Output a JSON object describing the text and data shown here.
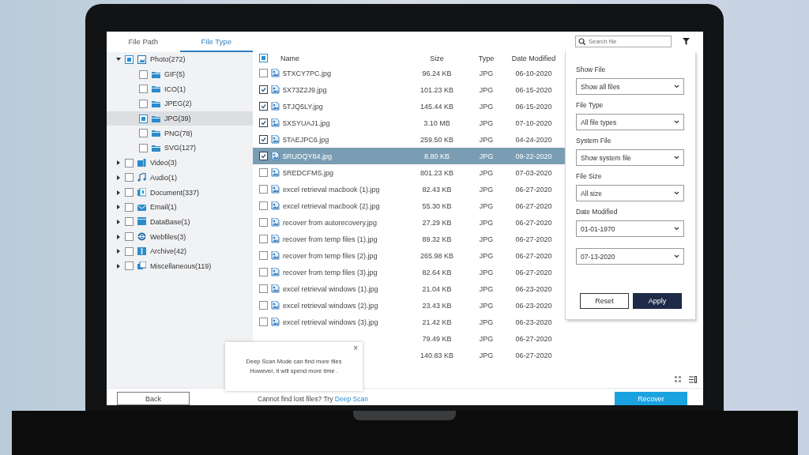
{
  "tabs": [
    {
      "label": "File Path",
      "selected": false
    },
    {
      "label": "File Type",
      "selected": true
    }
  ],
  "tree": [
    {
      "label": "Photo(272)",
      "kind": "image",
      "expanded": true,
      "partial": true,
      "selected": false,
      "children": [
        {
          "label": "GIF(5)",
          "kind": "folder",
          "partial": false,
          "selected": false
        },
        {
          "label": "ICO(1)",
          "kind": "folder",
          "partial": false,
          "selected": false
        },
        {
          "label": "JPEG(2)",
          "kind": "folder",
          "partial": false,
          "selected": false
        },
        {
          "label": "JPG(39)",
          "kind": "folder",
          "partial": true,
          "selected": true
        },
        {
          "label": "PNG(78)",
          "kind": "folder",
          "partial": false,
          "selected": false
        },
        {
          "label": "SVG(127)",
          "kind": "folder",
          "partial": false,
          "selected": false
        }
      ]
    },
    {
      "label": "Video(3)",
      "kind": "video",
      "expanded": false,
      "partial": false,
      "selected": false
    },
    {
      "label": "Audio(1)",
      "kind": "audio",
      "expanded": false,
      "partial": false,
      "selected": false
    },
    {
      "label": "Document(337)",
      "kind": "document",
      "expanded": false,
      "partial": false,
      "selected": false
    },
    {
      "label": "Email(1)",
      "kind": "email",
      "expanded": false,
      "partial": false,
      "selected": false
    },
    {
      "label": "DataBase(1)",
      "kind": "database",
      "expanded": false,
      "partial": false,
      "selected": false
    },
    {
      "label": "Webfiles(3)",
      "kind": "web",
      "expanded": false,
      "partial": false,
      "selected": false
    },
    {
      "label": "Archive(42)",
      "kind": "archive",
      "expanded": false,
      "partial": false,
      "selected": false
    },
    {
      "label": "Miscellaneous(119)",
      "kind": "misc",
      "expanded": false,
      "partial": false,
      "selected": false
    }
  ],
  "table": {
    "select_all": {
      "partial": true
    },
    "columns": [
      "Name",
      "Size",
      "Type",
      "Date Modified"
    ],
    "rows": [
      {
        "name": "5TXCY7PC.jpg",
        "size": "96.24 KB",
        "type": "JPG",
        "date": "06-10-2020",
        "checked": false,
        "selected": false
      },
      {
        "name": "5X73Z2J9.jpg",
        "size": "101.23 KB",
        "type": "JPG",
        "date": "06-15-2020",
        "checked": true,
        "selected": false
      },
      {
        "name": "5TJQ5LY.jpg",
        "size": "145.44 KB",
        "type": "JPG",
        "date": "06-15-2020",
        "checked": true,
        "selected": false
      },
      {
        "name": "5XSYUAJ1.jpg",
        "size": "3.10 MB",
        "type": "JPG",
        "date": "07-10-2020",
        "checked": true,
        "selected": false
      },
      {
        "name": "5TAEJPC6.jpg",
        "size": "259.50 KB",
        "type": "JPG",
        "date": "04-24-2020",
        "checked": true,
        "selected": false
      },
      {
        "name": "5RUDQY84.jpg",
        "size": "8.80 KB",
        "type": "JPG",
        "date": "09-22-2020",
        "checked": true,
        "selected": true
      },
      {
        "name": "5REDCFMS.jpg",
        "size": "801.23 KB",
        "type": "JPG",
        "date": "07-03-2020",
        "checked": false,
        "selected": false
      },
      {
        "name": "excel retrieval macbook (1).jpg",
        "size": "82.43 KB",
        "type": "JPG",
        "date": "06-27-2020",
        "checked": false,
        "selected": false
      },
      {
        "name": "excel retrieval macbook (2).jpg",
        "size": "55.30 KB",
        "type": "JPG",
        "date": "06-27-2020",
        "checked": false,
        "selected": false
      },
      {
        "name": "recover from autorecovery.jpg",
        "size": "27.29 KB",
        "type": "JPG",
        "date": "06-27-2020",
        "checked": false,
        "selected": false
      },
      {
        "name": "recover from temp files (1).jpg",
        "size": "89.32 KB",
        "type": "JPG",
        "date": "06-27-2020",
        "checked": false,
        "selected": false
      },
      {
        "name": "recover from temp files (2).jpg",
        "size": "265.98 KB",
        "type": "JPG",
        "date": "06-27-2020",
        "checked": false,
        "selected": false
      },
      {
        "name": "recover from temp files (3).jpg",
        "size": "82.64 KB",
        "type": "JPG",
        "date": "06-27-2020",
        "checked": false,
        "selected": false
      },
      {
        "name": "excel retrieval windows (1).jpg",
        "size": "21.04 KB",
        "type": "JPG",
        "date": "06-23-2020",
        "checked": false,
        "selected": false
      },
      {
        "name": "excel retrieval windows (2).jpg",
        "size": "23.43 KB",
        "type": "JPG",
        "date": "06-23-2020",
        "checked": false,
        "selected": false
      },
      {
        "name": "excel retrieval windows (3).jpg",
        "size": "21.42 KB",
        "type": "JPG",
        "date": "06-23-2020",
        "checked": false,
        "selected": false
      },
      {
        "size": "79.49 KB",
        "type": "JPG",
        "date": "06-27-2020",
        "selected": false
      },
      {
        "size": "140.83 KB",
        "type": "JPG",
        "date": "06-27-2020",
        "selected": false
      }
    ]
  },
  "search": {
    "placeholder": "Search file"
  },
  "filters": [
    {
      "label": "Show File",
      "value": "Show all files"
    },
    {
      "label": "File Type",
      "value": "All file types"
    },
    {
      "label": "System File",
      "value": "Show system file"
    },
    {
      "label": "File Size",
      "value": "All size"
    },
    {
      "label": "Date Modified",
      "value": "01-01-1970"
    },
    {
      "value": "07-13-2020"
    }
  ],
  "filter_buttons": [
    {
      "label": "Reset",
      "kind": "secondary"
    },
    {
      "label": "Apply",
      "kind": "primary"
    }
  ],
  "popup": {
    "lines": [
      "Deep Scan Mode can find more files",
      "However, it will spend more time ."
    ],
    "close": "×"
  },
  "bottom": {
    "back": "Back",
    "prompt": "Cannot find lost files? Try",
    "link": "Deep Scan",
    "recover": "Recover"
  }
}
